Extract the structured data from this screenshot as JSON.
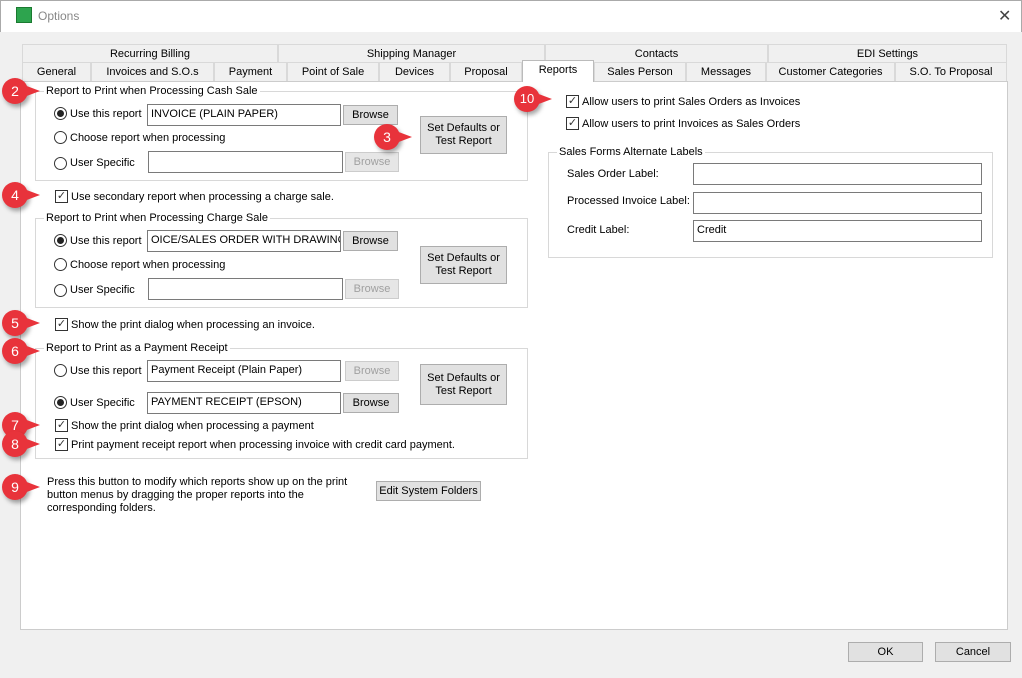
{
  "window": {
    "title": "Options",
    "close": "✕"
  },
  "tabs_row1": [
    "Recurring Billing",
    "Shipping Manager",
    "Contacts",
    "EDI Settings"
  ],
  "tabs_row2": [
    "General",
    "Invoices and S.O.s",
    "Payment",
    "Point of Sale",
    "Devices",
    "Proposal",
    "Reports",
    "Sales Person",
    "Messages",
    "Customer Categories",
    "S.O. To Proposal"
  ],
  "cash": {
    "legend": "Report to Print when Processing Cash Sale",
    "opt1": "Use this report",
    "opt2": "Choose report when processing",
    "opt3": "User Specific",
    "report": "INVOICE (PLAIN PAPER)",
    "user_report": "",
    "browse": "Browse",
    "defaults": "Set Defaults or Test Report"
  },
  "secondary": "Use secondary report when processing a charge sale.",
  "charge": {
    "legend": "Report to Print when Processing Charge Sale",
    "opt1": "Use this report",
    "opt2": "Choose report when processing",
    "opt3": "User Specific",
    "report": "OICE/SALES ORDER WITH DRAWING",
    "user_report": "",
    "browse": "Browse",
    "defaults": "Set Defaults or Test Report"
  },
  "show_dialog_invoice": "Show the print dialog when processing an invoice.",
  "receipt": {
    "legend": "Report to Print as a Payment Receipt",
    "opt1": "Use this report",
    "opt3": "User Specific",
    "report": "Payment Receipt (Plain Paper)",
    "user_report": "PAYMENT RECEIPT (EPSON)",
    "browse": "Browse",
    "defaults": "Set Defaults or Test Report",
    "show_dialog": "Show the print dialog when processing a payment",
    "print_cc": "Print payment receipt report when processing invoice with credit card payment."
  },
  "folders": {
    "text": "Press this button to modify which reports show up on the print button menus by dragging the proper reports into the corresponding folders.",
    "button": "Edit System Folders"
  },
  "right": {
    "allow_so": "Allow users to print Sales Orders as Invoices",
    "allow_inv": "Allow users to print Invoices as Sales Orders",
    "legend": "Sales Forms Alternate Labels",
    "so_label": "Sales Order Label:",
    "so_value": "",
    "pi_label": "Processed Invoice Label:",
    "pi_value": "",
    "credit_label": "Credit Label:",
    "credit_value": "Credit"
  },
  "footer": {
    "ok": "OK",
    "cancel": "Cancel"
  },
  "callouts": [
    "2",
    "3",
    "4",
    "5",
    "6",
    "7",
    "8",
    "9",
    "10"
  ],
  "colors": {
    "callout": "#e8333b"
  }
}
